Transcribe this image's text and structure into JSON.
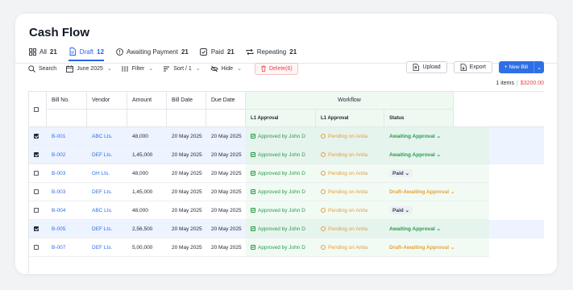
{
  "page": {
    "title": "Cash Flow"
  },
  "tabs": [
    {
      "label": "All",
      "count": "21",
      "icon": "grid-icon"
    },
    {
      "label": "Draft",
      "count": "12",
      "icon": "document-icon",
      "active": true
    },
    {
      "label": "Awaiting Payment",
      "count": "21",
      "icon": "alert-circle-icon"
    },
    {
      "label": "Paid",
      "count": "21",
      "icon": "check-square-icon"
    },
    {
      "label": "Repeating",
      "count": "21",
      "icon": "repeat-icon"
    }
  ],
  "toolbar": {
    "search_label": "Search",
    "date_label": "June 2025",
    "filter_label": "Filter",
    "sort_label": "Sort / 1",
    "hide_label": "Hide",
    "delete_label": "Delete(6)",
    "upload_label": "Upload",
    "export_label": "Export",
    "new_bill_label": "+ New Bill"
  },
  "summary": {
    "items": "1 items",
    "amount": "$3200.00"
  },
  "table": {
    "headers": {
      "bill_no": "Bill No.",
      "vendor": "Vendor",
      "amount": "Amount",
      "bill_date": "Bill Date",
      "due_date": "Due Date",
      "workflow": "Workflow",
      "l1_approval_a": "L1 Approval",
      "l1_approval_b": "L1 Approval",
      "status": "Status"
    },
    "rows": [
      {
        "selected": true,
        "bill_no": "B-001",
        "vendor": "ABC Lts.",
        "amount": "48,000",
        "bill_date": "20 May 2025",
        "due_date": "20 May 2025",
        "approval_a": "Approved by John D",
        "approval_b": "Pending on Anita",
        "status": "Awaiting Approval ⌄",
        "status_color": "#2a9a4a"
      },
      {
        "selected": true,
        "bill_no": "B-002",
        "vendor": "DEF Lts.",
        "amount": "1,45,000",
        "bill_date": "20 May 2025",
        "due_date": "20 May 2025",
        "approval_a": "Approved by John D",
        "approval_b": "Pending on Anita",
        "status": "Awaiting Approval ⌄",
        "status_color": "#2a9a4a"
      },
      {
        "selected": false,
        "bill_no": "B-003",
        "vendor": "GH Lts.",
        "amount": "48,000",
        "bill_date": "20 May 2025",
        "due_date": "20 May 2025",
        "approval_a": "Approved by John D",
        "approval_b": "Pending on Anita",
        "status": "Paid ⌄",
        "status_color": "#374151"
      },
      {
        "selected": false,
        "bill_no": "B-003",
        "vendor": "DEF Lts.",
        "amount": "1,45,000",
        "bill_date": "20 May 2025",
        "due_date": "20 May 2025",
        "approval_a": "Approved by John D",
        "approval_b": "Pending on Anita",
        "status": "Draft-Awaiting Approval ⌄",
        "status_color": "#e8a13a"
      },
      {
        "selected": false,
        "bill_no": "B-004",
        "vendor": "ABC Lts.",
        "amount": "48,000",
        "bill_date": "20 May 2025",
        "due_date": "20 May 2025",
        "approval_a": "Approved by John D",
        "approval_b": "Pending on Anita",
        "status": "Paid ⌄",
        "status_color": "#374151"
      },
      {
        "selected": true,
        "bill_no": "B-005",
        "vendor": "DEF Lts.",
        "amount": "2,56,500",
        "bill_date": "20 May 2025",
        "due_date": "20 May 2025",
        "approval_a": "Approved by John D",
        "approval_b": "Pending on Anita",
        "status": "Awaiting Approval ⌄",
        "status_color": "#2a9a4a"
      },
      {
        "selected": false,
        "bill_no": "B-007",
        "vendor": "DEF Lts.",
        "amount": "5,00,000",
        "bill_date": "20 May 2025",
        "due_date": "20 May 2025",
        "approval_a": "Approved by John D",
        "approval_b": "Pending on Anita",
        "status": "Draft-Awaiting Approval ⌄",
        "status_color": "#e8a13a"
      }
    ]
  },
  "colors": {
    "accent": "#2e6fe8",
    "approved": "#2a9a4a",
    "pending": "#e89c3a",
    "danger": "#e5484d",
    "workflow_bg": "#eefaf1"
  }
}
